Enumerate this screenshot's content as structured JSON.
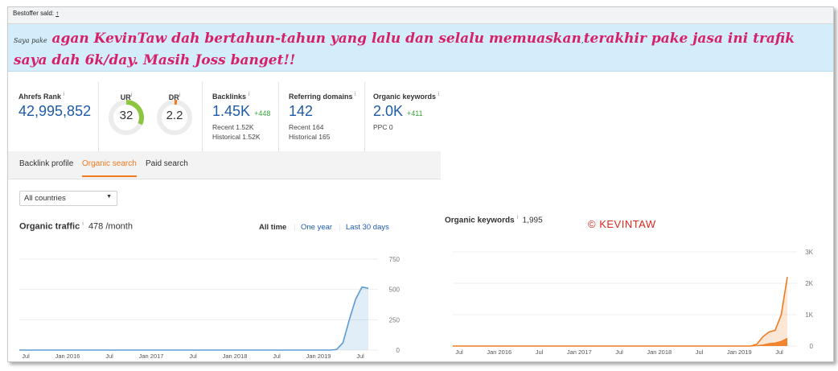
{
  "topbar": {
    "label": "Bestoffer sald:",
    "link": "↑"
  },
  "review": {
    "prefix": "Saya pake",
    "text1": "agan KevinTaw dah bertahun-tahun yang lalu dan selalu memuaskan",
    "comma": ",",
    "text2": "terakhir pake jasa ini trafik saya dah 6k/day. Masih Joss banget!!"
  },
  "metrics": {
    "ahrefs_rank": {
      "title": "Ahrefs Rank",
      "value": "42,995,852"
    },
    "ur": {
      "label": "UR",
      "value": "32",
      "fill": 0.32,
      "color": "#8cc63f"
    },
    "dr": {
      "label": "DR",
      "value": "2.2",
      "fill": 0.022,
      "color": "#f07a1e"
    },
    "backlinks": {
      "title": "Backlinks",
      "value": "1.45K",
      "delta": "+448",
      "recent": "Recent 1.52K",
      "historical": "Historical 1.52K"
    },
    "referring_domains": {
      "title": "Referring domains",
      "value": "142",
      "recent": "Recent 164",
      "historical": "Historical 165"
    },
    "organic_keywords": {
      "title": "Organic keywords",
      "value": "2.0K",
      "delta": "+411",
      "ppc": "PPC 0"
    }
  },
  "tabs": [
    {
      "label": "Backlink profile",
      "active": false
    },
    {
      "label": "Organic search",
      "active": true
    },
    {
      "label": "Paid search",
      "active": false
    }
  ],
  "country_select": {
    "value": "All countries"
  },
  "organic_traffic": {
    "title": "Organic traffic",
    "value": "478 /month"
  },
  "ranges": {
    "all": "All time",
    "year": "One year",
    "month": "Last 30 days"
  },
  "organic_keywords_chart": {
    "title": "Organic keywords",
    "value": "1,995"
  },
  "watermark": "© KEVINTAW",
  "info_glyph": "i",
  "chart_data": [
    {
      "type": "area",
      "title": "Organic traffic",
      "x": [
        "Jul",
        "Jan 2016",
        "Jul",
        "Jan 2017",
        "Jul",
        "Jan 2018",
        "Jul",
        "Jan 2019",
        "Jul"
      ],
      "yticks": [
        "750",
        "500",
        "250",
        "0"
      ],
      "ylim": [
        0,
        750
      ],
      "series": [
        {
          "values": [
            0,
            0,
            0,
            0,
            0,
            0,
            0,
            0,
            0,
            0,
            0,
            0,
            0,
            0,
            0,
            0,
            0,
            0,
            0,
            0,
            0,
            0,
            0,
            0,
            0,
            0,
            0,
            0,
            0,
            0,
            0,
            0,
            0,
            0,
            0,
            0,
            0,
            0,
            0,
            0,
            0,
            0,
            0,
            0,
            0,
            0,
            0,
            0,
            0,
            0,
            5,
            60,
            250,
            420,
            520,
            510
          ]
        }
      ],
      "color": "#5b9bd5"
    },
    {
      "type": "area",
      "title": "Organic keywords",
      "x": [
        "Jul",
        "Jan 2016",
        "Jul",
        "Jan 2017",
        "Jul",
        "Jan 2018",
        "Jul",
        "Jan 2019",
        "Jul"
      ],
      "yticks": [
        "3K",
        "2K",
        "1K",
        "0"
      ],
      "ylim": [
        0,
        3000
      ],
      "series": [
        {
          "values": [
            0,
            0,
            0,
            0,
            0,
            0,
            0,
            0,
            0,
            0,
            0,
            0,
            0,
            0,
            0,
            0,
            0,
            0,
            0,
            0,
            0,
            0,
            0,
            0,
            0,
            0,
            0,
            0,
            0,
            0,
            0,
            0,
            0,
            0,
            0,
            0,
            0,
            0,
            0,
            0,
            0,
            0,
            0,
            0,
            0,
            0,
            0,
            0,
            0,
            0,
            60,
            300,
            450,
            500,
            1000,
            2200
          ]
        },
        {
          "values": [
            0,
            0,
            0,
            0,
            0,
            0,
            0,
            0,
            0,
            0,
            0,
            0,
            0,
            0,
            0,
            0,
            0,
            0,
            0,
            0,
            0,
            0,
            0,
            0,
            0,
            0,
            0,
            0,
            0,
            0,
            0,
            0,
            0,
            0,
            0,
            0,
            0,
            0,
            0,
            0,
            0,
            0,
            0,
            0,
            0,
            0,
            0,
            0,
            0,
            0,
            10,
            40,
            80,
            100,
            150,
            250
          ]
        }
      ],
      "color": "#f07a1e"
    }
  ]
}
